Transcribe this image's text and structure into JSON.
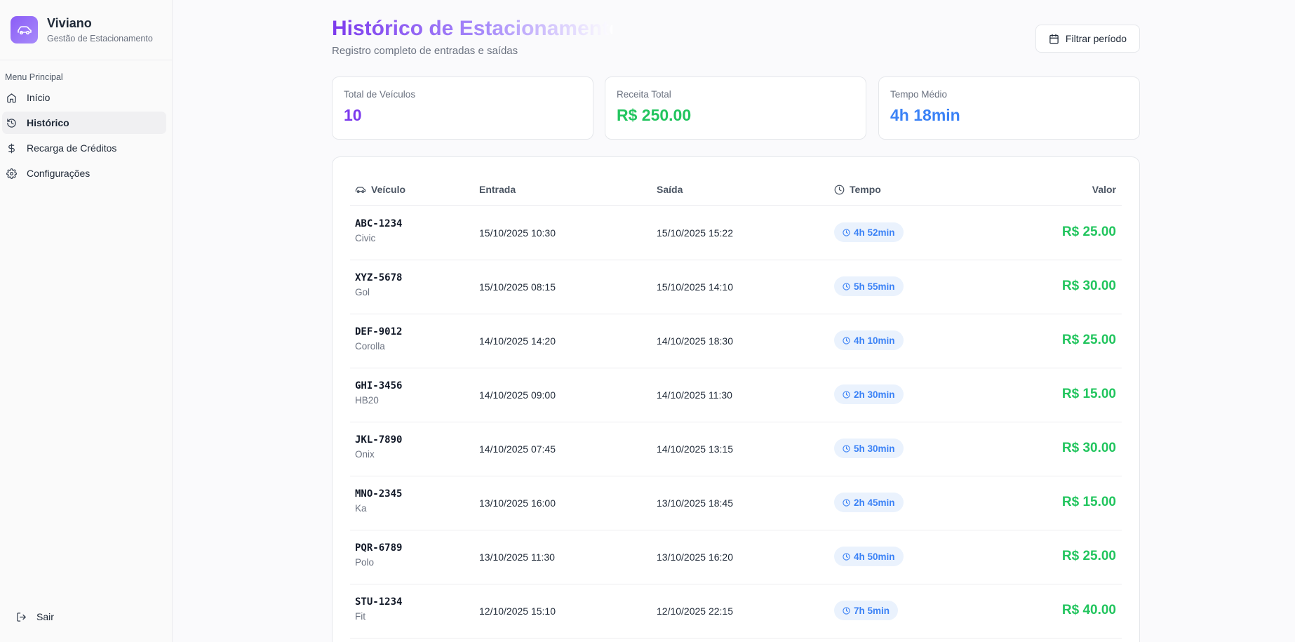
{
  "brand": {
    "name": "Viviano",
    "subtitle": "Gestão de Estacionamento",
    "logo_icon": "car-icon"
  },
  "sidebar": {
    "menu_title": "Menu Principal",
    "items": [
      {
        "label": "Início",
        "icon": "home-icon",
        "active": false
      },
      {
        "label": "Histórico",
        "icon": "history-icon",
        "active": true
      },
      {
        "label": "Recarga de Créditos",
        "icon": "dollar-icon",
        "active": false
      },
      {
        "label": "Configurações",
        "icon": "gear-icon",
        "active": false
      }
    ],
    "logout": {
      "label": "Sair",
      "icon": "logout-icon"
    }
  },
  "header": {
    "title": "Histórico de Estacionamento",
    "subtitle": "Registro completo de entradas e saídas",
    "filter_label": "Filtrar período"
  },
  "stats": [
    {
      "label": "Total de Veículos",
      "value": "10",
      "color": "#7c3aed"
    },
    {
      "label": "Receita Total",
      "value": "R$ 250.00",
      "color": "#22c55e"
    },
    {
      "label": "Tempo Médio",
      "value": "4h 18min",
      "color": "#3b82f6"
    }
  ],
  "table": {
    "columns": {
      "vehicle": "Veículo",
      "entry": "Entrada",
      "exit": "Saída",
      "time": "Tempo",
      "value": "Valor"
    },
    "rows": [
      {
        "plate": "ABC-1234",
        "model": "Civic",
        "entry": "15/10/2025 10:30",
        "exit": "15/10/2025 15:22",
        "time": "4h 52min",
        "value": "R$ 25.00"
      },
      {
        "plate": "XYZ-5678",
        "model": "Gol",
        "entry": "15/10/2025 08:15",
        "exit": "15/10/2025 14:10",
        "time": "5h 55min",
        "value": "R$ 30.00"
      },
      {
        "plate": "DEF-9012",
        "model": "Corolla",
        "entry": "14/10/2025 14:20",
        "exit": "14/10/2025 18:30",
        "time": "4h 10min",
        "value": "R$ 25.00"
      },
      {
        "plate": "GHI-3456",
        "model": "HB20",
        "entry": "14/10/2025 09:00",
        "exit": "14/10/2025 11:30",
        "time": "2h 30min",
        "value": "R$ 15.00"
      },
      {
        "plate": "JKL-7890",
        "model": "Onix",
        "entry": "14/10/2025 07:45",
        "exit": "14/10/2025 13:15",
        "time": "5h 30min",
        "value": "R$ 30.00"
      },
      {
        "plate": "MNO-2345",
        "model": "Ka",
        "entry": "13/10/2025 16:00",
        "exit": "13/10/2025 18:45",
        "time": "2h 45min",
        "value": "R$ 15.00"
      },
      {
        "plate": "PQR-6789",
        "model": "Polo",
        "entry": "13/10/2025 11:30",
        "exit": "13/10/2025 16:20",
        "time": "4h 50min",
        "value": "R$ 25.00"
      },
      {
        "plate": "STU-1234",
        "model": "Fit",
        "entry": "12/10/2025 15:10",
        "exit": "12/10/2025 22:15",
        "time": "7h 5min",
        "value": "R$ 40.00"
      }
    ]
  }
}
